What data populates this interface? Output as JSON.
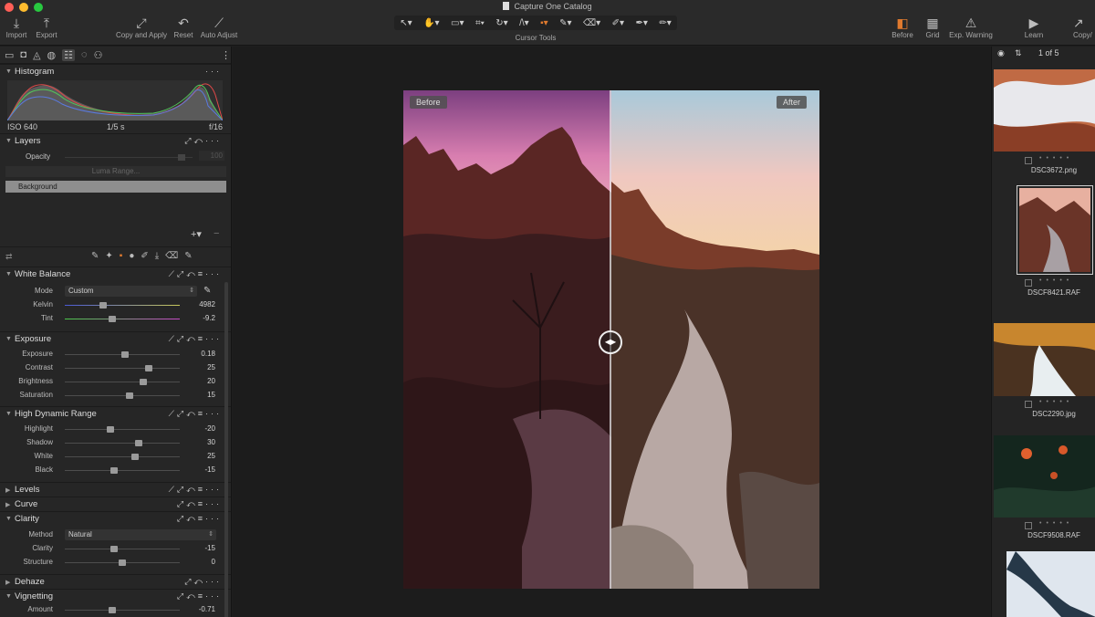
{
  "window": {
    "title": "Capture One Catalog"
  },
  "colors": {
    "close": "#ff5f57",
    "minimize": "#febc2e",
    "zoom": "#28c840",
    "accent": "#e07a2e"
  },
  "toolbar": {
    "import": "Import",
    "export": "Export",
    "copy_apply": "Copy and Apply",
    "reset": "Reset",
    "auto_adjust": "Auto Adjust",
    "cursor_tools": "Cursor Tools",
    "before": "Before",
    "grid": "Grid",
    "exp_warning": "Exp. Warning",
    "learn": "Learn",
    "copy_cut": "Copy/"
  },
  "histogram": {
    "title": "Histogram",
    "iso": "ISO 640",
    "shutter": "1/5 s",
    "aperture": "f/16"
  },
  "layers": {
    "title": "Layers",
    "opacity_label": "Opacity",
    "opacity_value": "100",
    "luma_range": "Luma Range...",
    "background": "Background"
  },
  "white_balance": {
    "title": "White Balance",
    "mode_label": "Mode",
    "mode_value": "Custom",
    "kelvin_label": "Kelvin",
    "kelvin_value": "4982",
    "kelvin_pos": 0.33,
    "tint_label": "Tint",
    "tint_value": "-9.2",
    "tint_pos": 0.41
  },
  "exposure": {
    "title": "Exposure",
    "rows": [
      {
        "label": "Exposure",
        "value": "0.18",
        "pos": 0.52
      },
      {
        "label": "Contrast",
        "value": "25",
        "pos": 0.73
      },
      {
        "label": "Brightness",
        "value": "20",
        "pos": 0.68
      },
      {
        "label": "Saturation",
        "value": "15",
        "pos": 0.56
      }
    ]
  },
  "hdr": {
    "title": "High Dynamic Range",
    "rows": [
      {
        "label": "Highlight",
        "value": "-20",
        "pos": 0.4
      },
      {
        "label": "Shadow",
        "value": "30",
        "pos": 0.64
      },
      {
        "label": "White",
        "value": "25",
        "pos": 0.61
      },
      {
        "label": "Black",
        "value": "-15",
        "pos": 0.43
      }
    ]
  },
  "levels": {
    "title": "Levels"
  },
  "curve": {
    "title": "Curve"
  },
  "clarity": {
    "title": "Clarity",
    "method_label": "Method",
    "method_value": "Natural",
    "rows": [
      {
        "label": "Clarity",
        "value": "-15",
        "pos": 0.43
      },
      {
        "label": "Structure",
        "value": "0",
        "pos": 0.5
      }
    ]
  },
  "dehaze": {
    "title": "Dehaze"
  },
  "vignetting": {
    "title": "Vignetting",
    "amount_label": "Amount",
    "amount_value": "-0.71",
    "amount_pos": 0.41
  },
  "viewer": {
    "before_badge": "Before",
    "after_badge": "After"
  },
  "browser": {
    "count": "1 of 5",
    "thumbs": [
      {
        "name": "DSC3672.png"
      },
      {
        "name": "DSCF8421.RAF"
      },
      {
        "name": "DSC2290.jpg"
      },
      {
        "name": "DSCF9508.RAF"
      }
    ]
  }
}
